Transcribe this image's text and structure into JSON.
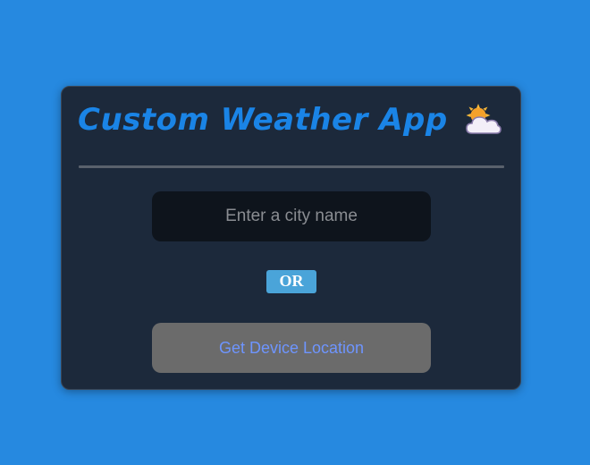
{
  "app": {
    "title": "Custom Weather App",
    "title_icon": "sun-behind-cloud-icon"
  },
  "search": {
    "placeholder": "Enter a city name",
    "value": ""
  },
  "separator": {
    "label": "OR"
  },
  "location": {
    "button_label": "Get Device Location"
  },
  "colors": {
    "page_background": "#2689e0",
    "card_background": "#1c293b",
    "title_color": "#1a84e6",
    "divider": "#59616c",
    "input_background": "#0e141c",
    "or_badge": "#4aa4d9",
    "button_background": "#6b6b6b",
    "button_text": "#6e95ff"
  }
}
